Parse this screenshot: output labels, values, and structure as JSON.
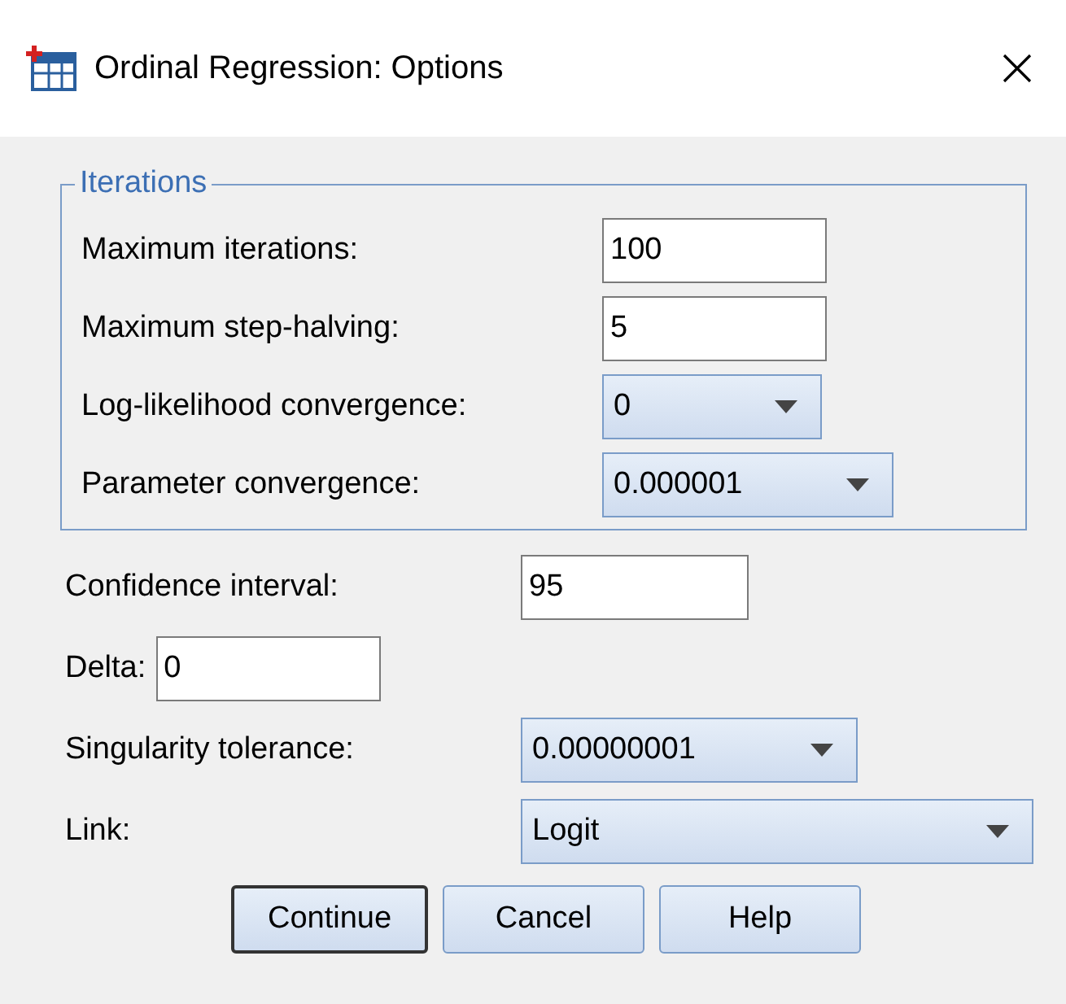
{
  "window": {
    "title": "Ordinal Regression: Options"
  },
  "iterations": {
    "title": "Iterations",
    "fields": [
      {
        "kind": "input",
        "label": "Maximum iterations:",
        "value": "100"
      },
      {
        "kind": "input",
        "label": "Maximum step-halving:",
        "value": "5"
      },
      {
        "kind": "dropdown",
        "label": "Log-likelihood convergence:",
        "value": "0"
      },
      {
        "kind": "dropdown",
        "label": "Parameter convergence:",
        "value": "0.000001"
      }
    ]
  },
  "fields": [
    {
      "kind": "input",
      "label": "Confidence interval:",
      "value": "95"
    },
    {
      "kind": "input",
      "label": "Delta:",
      "value": "0"
    },
    {
      "kind": "dropdown",
      "label": "Singularity tolerance:",
      "value": "0.00000001"
    },
    {
      "kind": "dropdown",
      "label": "Link:",
      "value": "Logit"
    }
  ],
  "buttons": [
    {
      "label": "Continue",
      "focused": true
    },
    {
      "label": "Cancel",
      "focused": false
    },
    {
      "label": "Help",
      "focused": false
    }
  ]
}
